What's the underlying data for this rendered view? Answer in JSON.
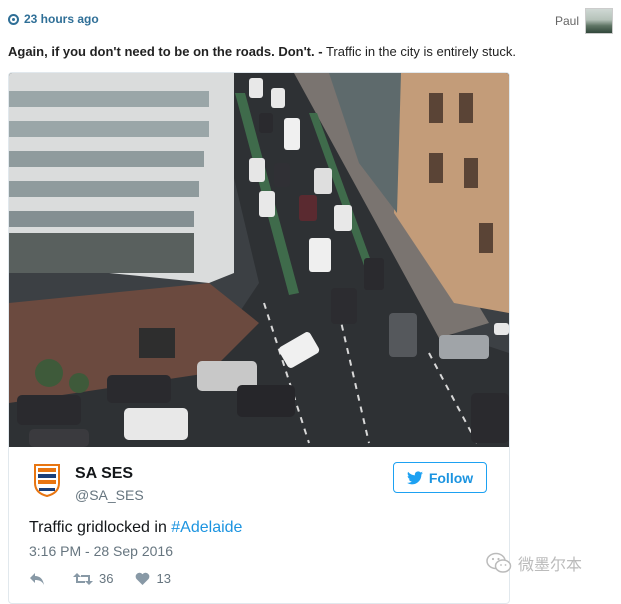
{
  "header": {
    "time_label": "23 hours ago",
    "user_name": "Paul"
  },
  "post": {
    "headline_bold": "Again, if you don't need to be on the roads. Don't. -",
    "headline_rest": " Traffic in the city is entirely stuck."
  },
  "embed": {
    "account_name": "SA SES",
    "account_handle": "@SA_SES",
    "follow_label": "Follow",
    "text_prefix": "Traffic gridlocked in ",
    "hashtag": "#Adelaide",
    "timestamp": "3:16 PM - 28 Sep 2016",
    "retweets": "36",
    "likes": "13"
  },
  "watermark": {
    "text": "微墨尔本"
  },
  "colors": {
    "link": "#1c94e0",
    "time": "#2f6f97"
  },
  "icons": [
    "clock-dot-icon",
    "twitter-bird-icon",
    "reply-icon",
    "retweet-icon",
    "heart-icon",
    "wechat-icon"
  ]
}
